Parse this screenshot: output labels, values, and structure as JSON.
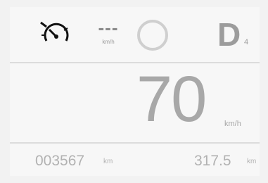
{
  "top": {
    "cruise_value": "---",
    "cruise_unit": "km/h",
    "gear": "D",
    "gear_sub": "4"
  },
  "speed": {
    "value": "70",
    "unit": "km/h"
  },
  "odometer": {
    "value": "003567",
    "unit": "km"
  },
  "trip": {
    "value": "317.5",
    "unit": "km"
  },
  "icons": {
    "speed_limiter": "speedometer-icon",
    "indicator": "circle-indicator-icon"
  },
  "colors": {
    "background": "#f2f2f2",
    "text": "#a8a8a8",
    "divider": "#dcdcdc"
  }
}
